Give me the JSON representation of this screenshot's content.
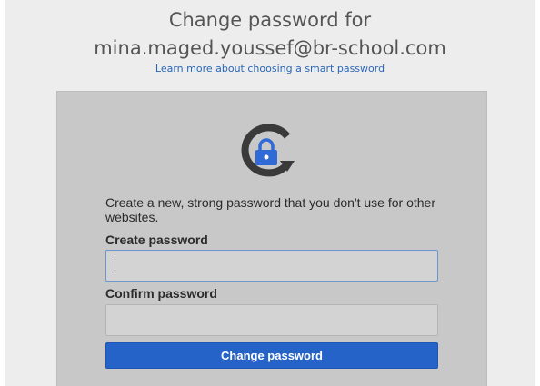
{
  "header": {
    "title_line1": "Change password for",
    "title_line2": "mina.maged.youssef@br-school.com",
    "learn_more_link": "Learn more about choosing a smart password"
  },
  "form": {
    "icon": "lock-refresh-icon",
    "description": "Create a new, strong password that you don't use for other websites.",
    "create_label": "Create password",
    "create_value": "",
    "confirm_label": "Confirm password",
    "confirm_value": "",
    "submit_label": "Change password"
  },
  "colors": {
    "accent": "#2563c9",
    "link": "#2a66b8",
    "card_background": "#c8c8c8",
    "icon_dark": "#3a3a3a"
  }
}
